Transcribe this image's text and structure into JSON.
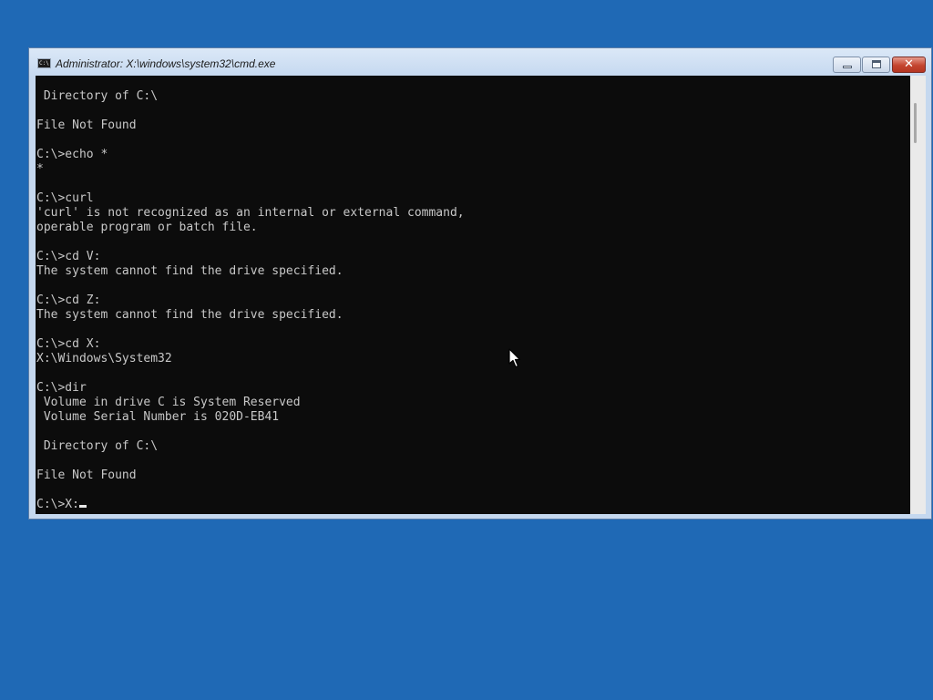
{
  "window": {
    "title": "Administrator: X:\\windows\\system32\\cmd.exe",
    "app_icon_text": "C:\\",
    "close_glyph": "✕"
  },
  "console": {
    "lines": [
      "",
      " Directory of C:\\",
      "",
      "File Not Found",
      "",
      "C:\\>echo *",
      "*",
      "",
      "C:\\>curl",
      "'curl' is not recognized as an internal or external command,",
      "operable program or batch file.",
      "",
      "C:\\>cd V:",
      "The system cannot find the drive specified.",
      "",
      "C:\\>cd Z:",
      "The system cannot find the drive specified.",
      "",
      "C:\\>cd X:",
      "X:\\Windows\\System32",
      "",
      "C:\\>dir",
      " Volume in drive C is System Reserved",
      " Volume Serial Number is 020D-EB41",
      "",
      " Directory of C:\\",
      "",
      "File Not Found",
      ""
    ],
    "prompt": "C:\\>X:"
  },
  "colors": {
    "desktop": "#1f69b5",
    "console_background": "#0c0c0c",
    "console_text": "#c8c8c8",
    "close_button": "#c4452f"
  }
}
